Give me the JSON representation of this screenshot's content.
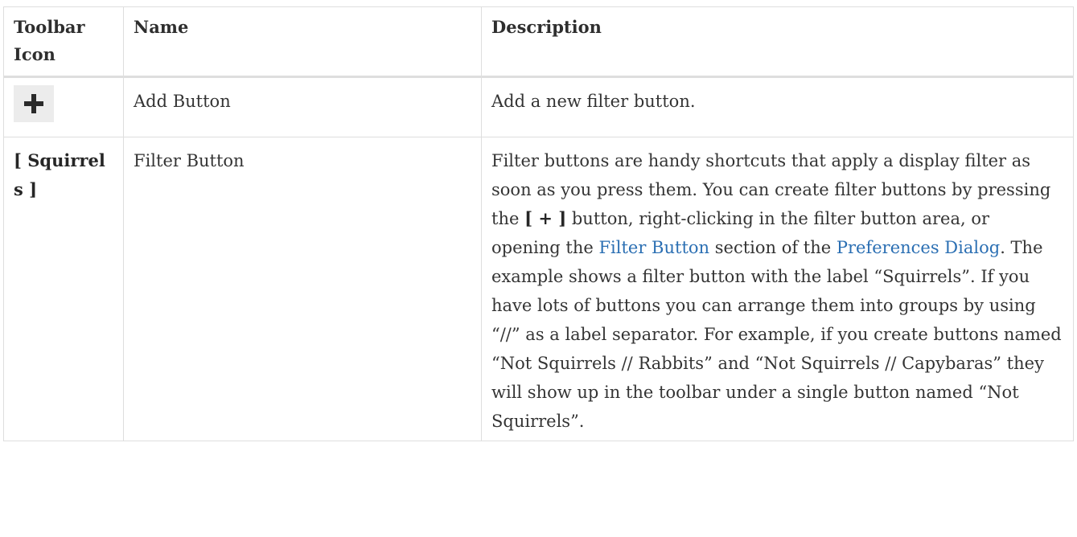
{
  "table": {
    "headers": [
      "Toolbar Icon",
      "Name",
      "Description"
    ],
    "rows": [
      {
        "icon_name": "plus-icon",
        "name": "Add Button",
        "description": "Add a new filter button."
      },
      {
        "icon_label": "[ Squirrels ]",
        "name": "Filter Button",
        "description": {
          "p1": "Filter buttons are handy shortcuts that apply a display filter as soon as you press them. You can create filter buttons by pressing the ",
          "bold": "[ + ]",
          "p2": " button, right-clicking in the filter button area, or opening the ",
          "link1": "Filter Button",
          "p3": " section of the ",
          "link2": "Preferences Dialog",
          "p4": ". The example shows a filter button with the label “Squirrels”. If you have lots of buttons you can arrange them into groups by using “//” as a label separator. For example, if you create buttons named “Not Squirrels // Rabbits” and “Not Squirrels // Capybaras” they will show up in the toolbar under a single button named “Not Squirrels”."
        }
      }
    ]
  },
  "colors": {
    "link": "#2b6fb3",
    "border": "#dedede",
    "icon_bg": "#ececec"
  }
}
